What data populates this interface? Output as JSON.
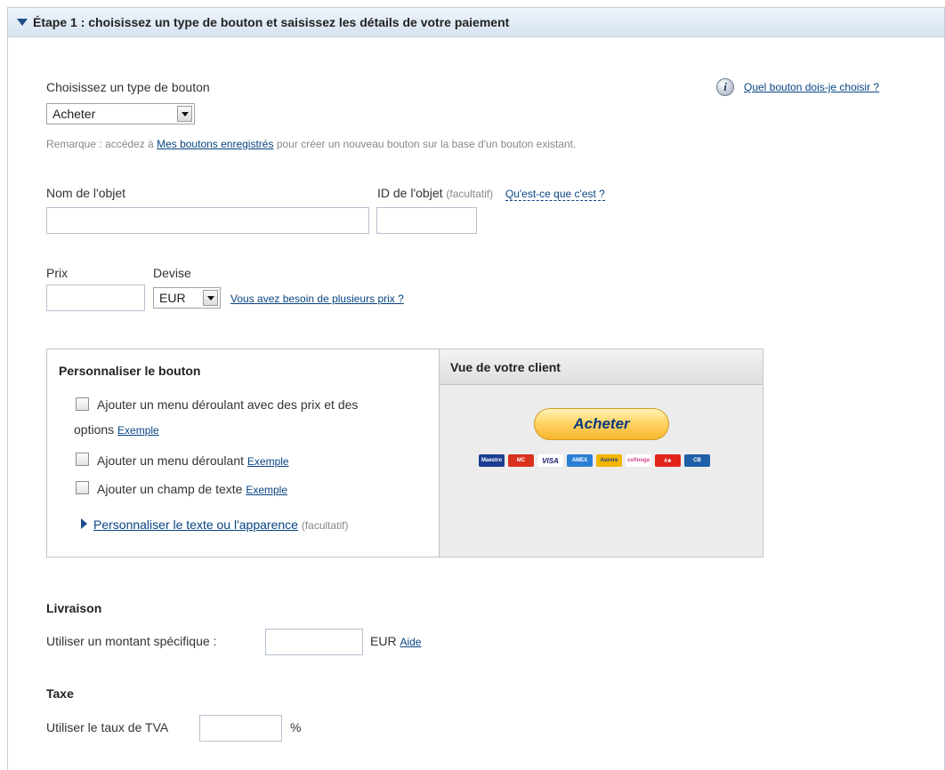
{
  "header": {
    "title": "Étape 1 : choisissez un type de bouton et saisissez les détails de votre paiement"
  },
  "button_type": {
    "label": "Choisissez un type de bouton",
    "selected": "Acheter",
    "help_link": "Quel bouton dois-je choisir ?",
    "note_prefix": "Remarque : accédez à ",
    "note_link": "Mes boutons enregistrés",
    "note_suffix": " pour créer un nouveau bouton sur la base d'un bouton existant."
  },
  "item": {
    "name_label": "Nom de l'objet",
    "name_value": "",
    "id_label": "ID de l'objet",
    "id_optional": "(facultatif)",
    "id_help": "Qu'est-ce que c'est ?",
    "id_value": ""
  },
  "price": {
    "price_label": "Prix",
    "price_value": "",
    "currency_label": "Devise",
    "currency_selected": "EUR",
    "multi_price_link": "Vous avez besoin de plusieurs prix ?"
  },
  "customize": {
    "title": "Personnaliser le bouton",
    "option1_line1": "Ajouter un menu déroulant avec des prix et des",
    "option1_line2": "options",
    "option2": "Ajouter un menu déroulant",
    "option3": "Ajouter un champ de texte",
    "example_link": "Exemple",
    "appearance_link": "Personnaliser le texte ou l'apparence",
    "appearance_optional": "(facultatif)",
    "options_checked": [
      false,
      false,
      false
    ]
  },
  "preview": {
    "title": "Vue de votre client",
    "button_label": "Acheter",
    "cards": [
      {
        "name": "Maestro",
        "color": "#1b3c8f"
      },
      {
        "name": "MasterCard",
        "color": "#d9331f"
      },
      {
        "name": "VISA",
        "color": "#ffffff"
      },
      {
        "name": "AMEX",
        "color": "#2a7fd4"
      },
      {
        "name": "Aurore",
        "color": "#f2b600"
      },
      {
        "name": "Cofinoga",
        "color": "#ffffff"
      },
      {
        "name": "4 étoiles",
        "color": "#e2231a"
      },
      {
        "name": "CB",
        "color": "#1f5fa8"
      }
    ]
  },
  "shipping": {
    "title": "Livraison",
    "label": "Utiliser un montant spécifique :",
    "value": "",
    "currency": "EUR",
    "help_link": "Aide"
  },
  "tax": {
    "title": "Taxe",
    "label": "Utiliser le taux de TVA",
    "value": "",
    "unit": "%"
  },
  "colors": {
    "link": "#084482",
    "header_bg": "#d6e3f1",
    "preview_bg": "#ececec"
  }
}
